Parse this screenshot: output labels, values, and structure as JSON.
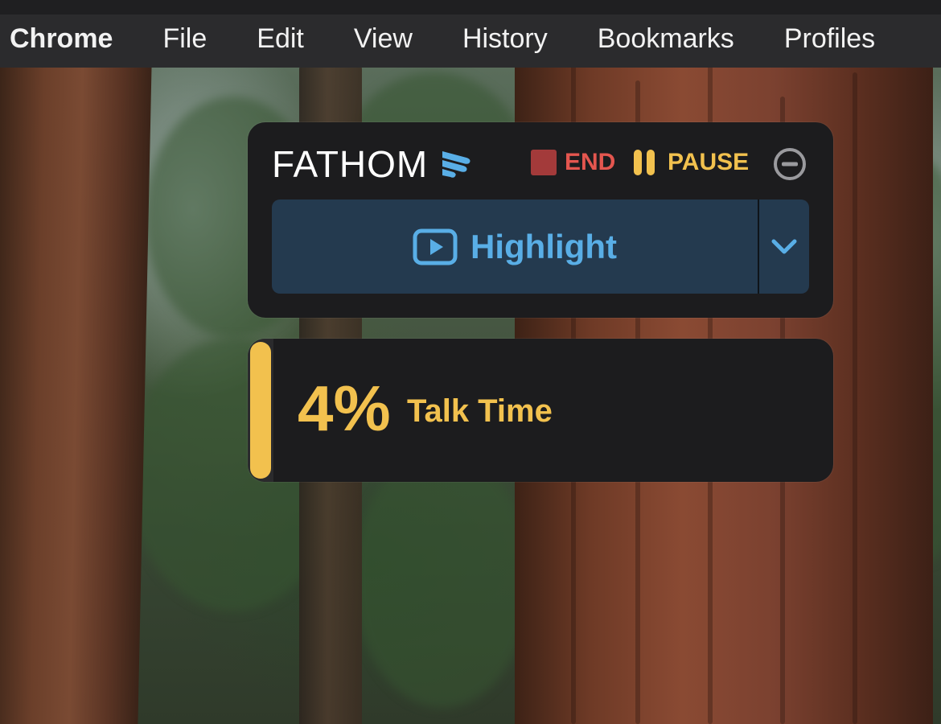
{
  "menubar": {
    "items": [
      {
        "label": "Chrome"
      },
      {
        "label": "File"
      },
      {
        "label": "Edit"
      },
      {
        "label": "View"
      },
      {
        "label": "History"
      },
      {
        "label": "Bookmarks"
      },
      {
        "label": "Profiles"
      }
    ]
  },
  "widget": {
    "brand": "FATHOM",
    "end_label": "END",
    "pause_label": "PAUSE",
    "highlight_label": "Highlight",
    "icons": {
      "logo": "fathom-logo-icon",
      "end": "stop-square-icon",
      "pause": "pause-icon",
      "minimize": "minus-circle-icon",
      "highlight": "play-video-icon",
      "dropdown": "chevron-down-icon"
    }
  },
  "talk_time": {
    "value": "4%",
    "label": "Talk Time",
    "percent": 4
  },
  "colors": {
    "panel": "#1c1c1e",
    "accent_blue": "#59aee6",
    "highlight_bg": "#243a4f",
    "end_red": "#e4564f",
    "pause_yellow": "#f2c14e",
    "menubar": "#2b2b2d"
  }
}
